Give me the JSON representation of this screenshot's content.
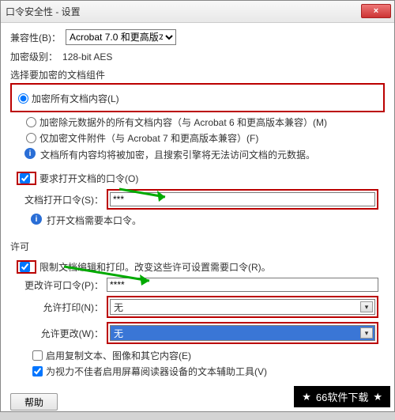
{
  "title": "口令安全性 - 设置",
  "close_x": "×",
  "compat": {
    "label": "兼容性(B)：",
    "value": "Acrobat 7.0 和更高版本"
  },
  "enc_level": {
    "label": "加密级别：",
    "value": "128-bit AES"
  },
  "enc_group": {
    "title": "选择要加密的文档组件",
    "opt_all": "加密所有文档内容(L)",
    "opt_meta": "加密除元数据外的所有文档内容（与 Acrobat 6 和更高版本兼容）(M)",
    "opt_attach": "仅加密文件附件（与 Acrobat 7 和更高版本兼容）(F)",
    "info": "文档所有内容均将被加密，且搜索引擎将无法访问文档的元数据。"
  },
  "open_pw": {
    "chk": "要求打开文档的口令(O)",
    "field_label": "文档打开口令(S)：",
    "value": "***",
    "info": "打开文档需要本口令。"
  },
  "perm": {
    "title": "许可",
    "chk": "限制文档编辑和打印。改变这些许可设置需要口令(R)。",
    "change_pw_label": "更改许可口令(P)：",
    "change_pw_value": "****",
    "allow_print_label": "允许打印(N)：",
    "allow_print_value": "无",
    "allow_change_label": "允许更改(W)：",
    "allow_change_value": "无",
    "copy_chk": "启用复制文本、图像和其它内容(E)",
    "screenreader_chk": "为视力不佳者启用屏幕阅读器设备的文本辅助工具(V)"
  },
  "help": "帮助",
  "banner": "66软件下载"
}
